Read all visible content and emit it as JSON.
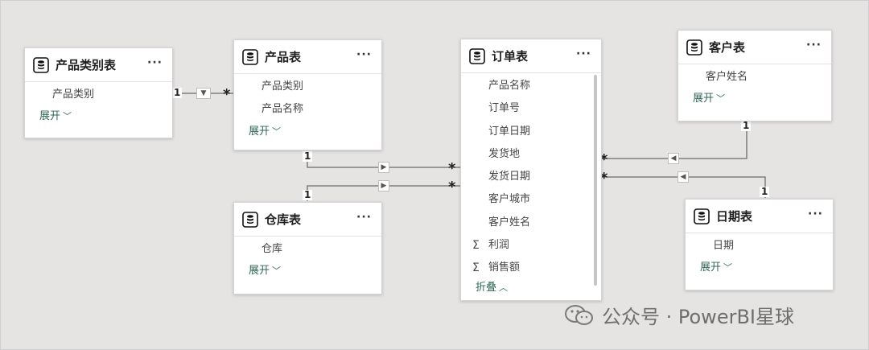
{
  "tables": {
    "category": {
      "title": "产品类别表",
      "fields": [
        "产品类别"
      ],
      "toggle": "展开"
    },
    "product": {
      "title": "产品表",
      "fields": [
        "产品类别",
        "产品名称"
      ],
      "toggle": "展开"
    },
    "warehouse": {
      "title": "仓库表",
      "fields": [
        "仓库"
      ],
      "toggle": "展开"
    },
    "order": {
      "title": "订单表",
      "fields": [
        "产品名称",
        "订单号",
        "订单日期",
        "发货地",
        "发货日期",
        "客户城市",
        "客户姓名"
      ],
      "measures": [
        "利润",
        "销售额"
      ],
      "toggle": "折叠"
    },
    "customer": {
      "title": "客户表",
      "fields": [
        "客户姓名"
      ],
      "toggle": "展开"
    },
    "date": {
      "title": "日期表",
      "fields": [
        "日期"
      ],
      "toggle": "展开"
    }
  },
  "cardinality": {
    "one": "1",
    "many": "*"
  },
  "icons": {
    "table": "database-icon",
    "more": "more-options-icon",
    "expand": "chevron-down-icon",
    "collapse": "chevron-up-icon",
    "filter": "filter-direction-icon",
    "sigma": "sigma-icon",
    "wechat": "wechat-icon"
  },
  "more_glyph": "···",
  "sigma_glyph": "Σ",
  "watermark": "公众号 · PowerBI星球",
  "colors": {
    "canvas": "#e5e4e3",
    "card": "#ffffff",
    "accent": "#2c6a55"
  }
}
